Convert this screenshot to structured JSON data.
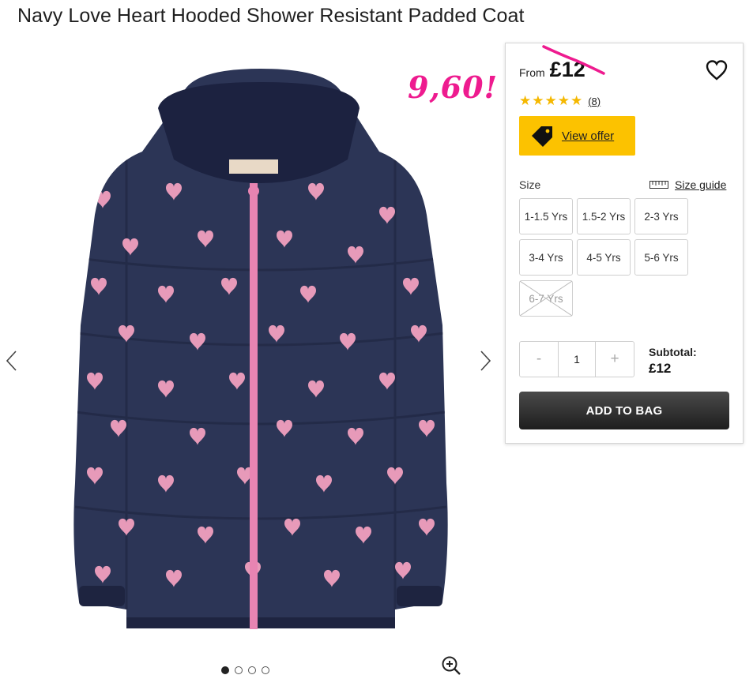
{
  "product": {
    "title": "Navy Love Heart Hooded Shower Resistant Padded Coat",
    "image_icon": "hooded-coat-image",
    "colors": {
      "coat": "#2c3556",
      "hearts": "#e79ab9",
      "zip": "#e884b2"
    }
  },
  "gallery": {
    "prev_icon": "chevron-left-icon",
    "next_icon": "chevron-right-icon",
    "zoom_icon": "zoom-in-icon",
    "dots_count": 4,
    "active_dot": 1
  },
  "annotation": {
    "text": "9,60!",
    "color": "#ee1b8f"
  },
  "buybox": {
    "from_label": "From",
    "price": "£12",
    "wishlist_icon": "heart-outline-icon",
    "rating": {
      "stars": 5,
      "stars_text": "★★★★★",
      "count": "(8)",
      "color": "#f5b800"
    },
    "offer": {
      "label": "View offer",
      "icon": "tag-icon",
      "color": "#fcc200"
    },
    "size": {
      "label": "Size",
      "guide_label": "Size guide",
      "guide_icon": "ruler-icon",
      "options": [
        {
          "label": "1-1.5 Yrs",
          "available": true
        },
        {
          "label": "1.5-2 Yrs",
          "available": true
        },
        {
          "label": "2-3 Yrs",
          "available": true
        },
        {
          "label": "3-4 Yrs",
          "available": true
        },
        {
          "label": "4-5 Yrs",
          "available": true
        },
        {
          "label": "5-6 Yrs",
          "available": true
        },
        {
          "label": "6-7 Yrs",
          "available": false
        }
      ]
    },
    "quantity": {
      "minus": "-",
      "value": "1",
      "plus": "+"
    },
    "subtotal": {
      "label": "Subtotal:",
      "value": "£12"
    },
    "add_to_bag": "ADD TO BAG"
  }
}
